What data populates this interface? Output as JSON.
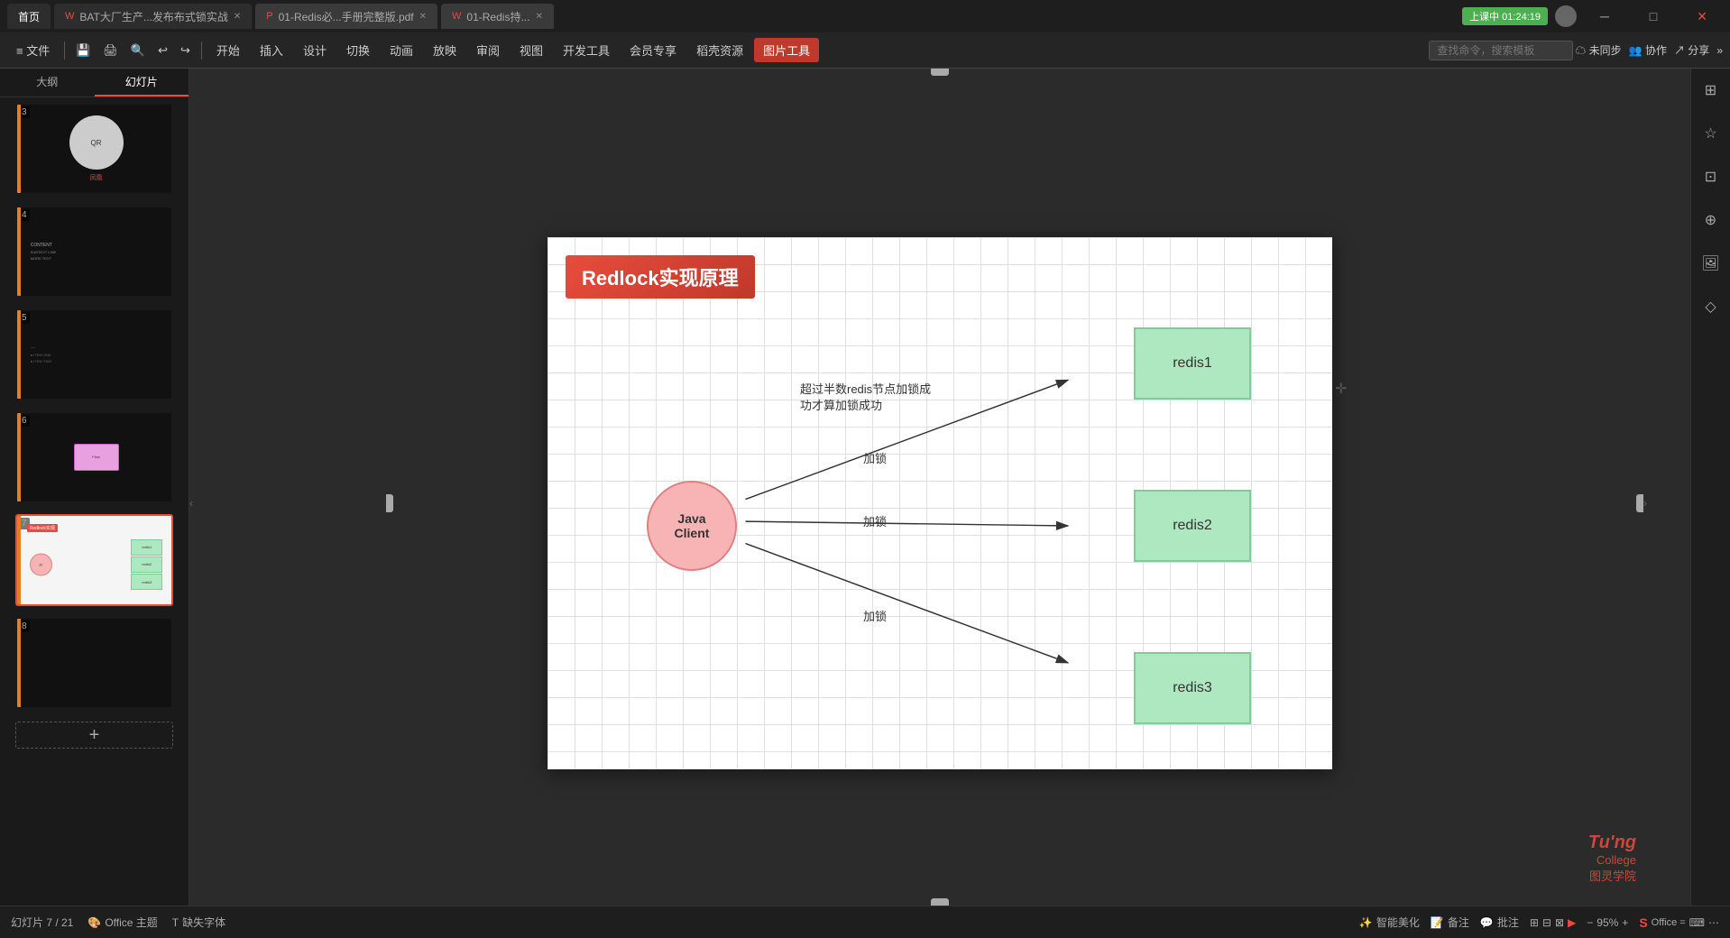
{
  "titleBar": {
    "tabs": [
      {
        "id": "home",
        "label": "首页",
        "active": true,
        "closable": false
      },
      {
        "id": "bat",
        "label": "BAT大厂生产...发布布式锁实战",
        "active": false,
        "closable": true,
        "icon": "wps"
      },
      {
        "id": "pdf1",
        "label": "01-Redis必...手册完整版.pdf",
        "active": false,
        "closable": true,
        "icon": "pdf"
      },
      {
        "id": "pdf2",
        "label": "01-Redis持...",
        "active": false,
        "closable": true,
        "icon": "wps"
      }
    ],
    "liveBadge": "上课中",
    "time": "01:24:19",
    "controls": [
      "minimize",
      "maximize",
      "close"
    ]
  },
  "menuBar": {
    "fileMenu": "≡ 文件",
    "icons": [
      "save",
      "print",
      "preview",
      "undo",
      "redo"
    ],
    "items": [
      "开始",
      "插入",
      "设计",
      "切换",
      "动画",
      "放映",
      "审阅",
      "视图",
      "开发工具",
      "会员专享",
      "稻壳资源"
    ],
    "activeItem": "图片工具",
    "searchPlaceholder": "查找命令，搜索模板",
    "rightActions": [
      "未同步",
      "协作",
      "分享"
    ]
  },
  "sidebar": {
    "tabs": [
      "大纲",
      "幻灯片"
    ],
    "activeTab": "幻灯片",
    "slides": [
      {
        "num": 3,
        "hasIndicator": true,
        "indicatorColor": "#e67e22"
      },
      {
        "num": 4,
        "hasIndicator": true,
        "indicatorColor": "#e67e22"
      },
      {
        "num": 5,
        "hasIndicator": true,
        "indicatorColor": "#e67e22"
      },
      {
        "num": 6,
        "hasIndicator": true,
        "indicatorColor": "#e67e22"
      },
      {
        "num": 7,
        "hasIndicator": true,
        "indicatorColor": "#e67e22",
        "active": true
      },
      {
        "num": 8,
        "hasIndicator": true,
        "indicatorColor": "#e67e22"
      }
    ],
    "addButtonLabel": "+"
  },
  "slide": {
    "title": "Redlock实现原理",
    "titleBg": "#e74c3c",
    "diagram": {
      "javaClient": {
        "line1": "Java",
        "line2": "Client"
      },
      "annotations": {
        "topArrow": "超过半数redis节点加锁成",
        "topArrow2": "功才算加锁成功",
        "lock1": "加锁",
        "lock2": "加锁",
        "lock3": "加锁"
      },
      "redisBoxes": [
        "redis1",
        "redis2",
        "redis3"
      ]
    }
  },
  "rightPanel": {
    "icons": [
      "layout",
      "star",
      "crop",
      "globe",
      "image",
      "shapes"
    ]
  },
  "bottomBar": {
    "slideInfo": "幻灯片 7 / 21",
    "theme": "Office 主题",
    "missingFont": "缺失字体",
    "smartBeautify": "智能美化",
    "notes": "备注",
    "comments": "批注",
    "zoomLevel": "95%",
    "officeLabel": "Office ="
  },
  "watermark": {
    "line1": "Tu'ng",
    "line2": "College",
    "line3": "图灵学院"
  }
}
